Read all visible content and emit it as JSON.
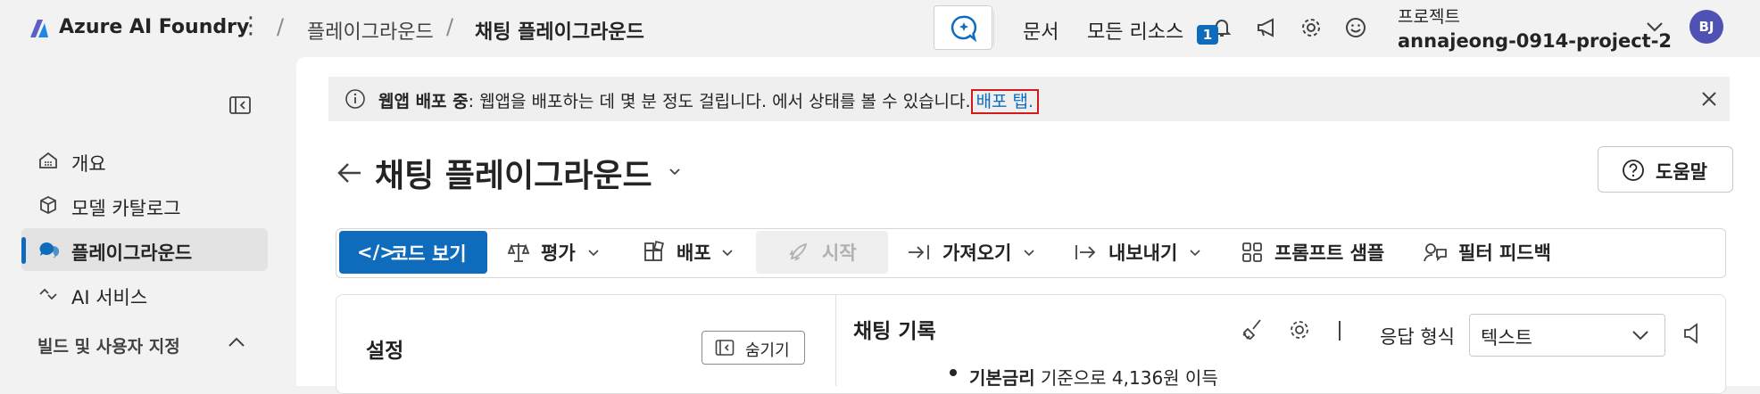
{
  "header": {
    "brand": "Azure AI Foundry",
    "breadcrumb": [
      "플레이그라운드",
      "채팅 플레이그라운드"
    ],
    "links": [
      "문서",
      "모든 리소스"
    ],
    "notification_count": "1",
    "project_label": "프로젝트",
    "project_name": "annajeong-0914-project-2",
    "avatar_initials": "BJ"
  },
  "sidebar": {
    "items": [
      {
        "label": "개요",
        "icon": "dashboard-icon"
      },
      {
        "label": "모델 카탈로그",
        "icon": "cube-icon"
      },
      {
        "label": "플레이그라운드",
        "icon": "chat-icon"
      },
      {
        "label": "AI 서비스",
        "icon": "link-icon"
      }
    ],
    "section": "빌드 및 사용자 지정"
  },
  "banner": {
    "bold": "웹앱 배포 중",
    "text": ": 웹앱을 배포하는 데 몇 분 정도 걸립니다. 에서 상태를 볼 수 있습니다.",
    "link": "배포 탭."
  },
  "page": {
    "title": "채팅 플레이그라운드",
    "help": "도움말"
  },
  "toolbar": {
    "code": "코드 보기",
    "evaluate": "평가",
    "deploy": "배포",
    "start": "시작",
    "import": "가져오기",
    "export": "내보내기",
    "prompt_samples": "프롬프트 샘플",
    "filter_feedback": "필터 피드백"
  },
  "settings": {
    "title": "설정",
    "hide": "숨기기"
  },
  "chat": {
    "title": "채팅 기록",
    "response_format_label": "응답 형식",
    "response_format_value": "텍스트",
    "message_bold": "기본금리",
    "message_text": " 기준으로 4,136원 이득"
  },
  "colors": {
    "accent": "#0f6cbd",
    "highlight": "#d21a1a"
  }
}
